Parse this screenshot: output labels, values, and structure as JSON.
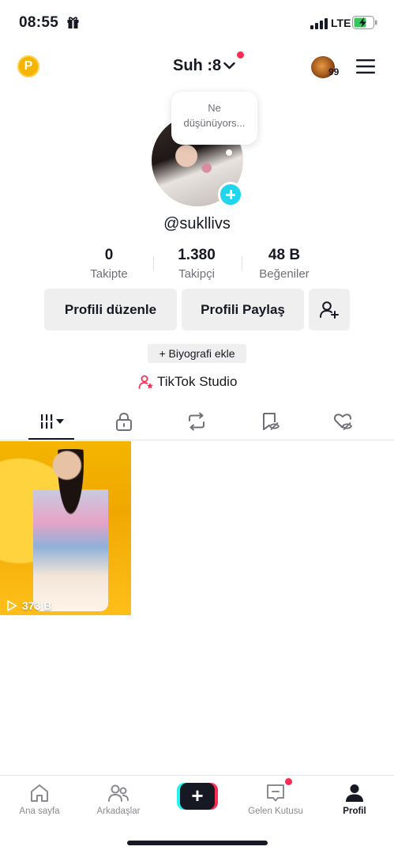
{
  "status_bar": {
    "time": "08:55",
    "network": "LTE"
  },
  "header": {
    "username": "Suh :8",
    "visitor_count": "99"
  },
  "profile": {
    "thought_bubble": [
      "Ne",
      "düşünüyors..."
    ],
    "handle": "@sukllivs",
    "stats": [
      {
        "value": "0",
        "label": "Takipte"
      },
      {
        "value": "1.380",
        "label": "Takipçi"
      },
      {
        "value": "48 B",
        "label": "Beğeniler"
      }
    ],
    "edit_button": "Profili düzenle",
    "share_button": "Profili Paylaş",
    "bio_button": "+ Biyografi ekle",
    "studio_link": "TikTok Studio"
  },
  "videos": [
    {
      "views": "373 B"
    }
  ],
  "bottom_nav": {
    "home": "Ana sayfa",
    "friends": "Arkadaşlar",
    "inbox": "Gelen Kutusu",
    "profile": "Profil"
  },
  "colors": {
    "accent_red": "#fe2c55",
    "accent_cyan": "#20d5ec",
    "text": "#161823",
    "muted": "#6f7077"
  }
}
